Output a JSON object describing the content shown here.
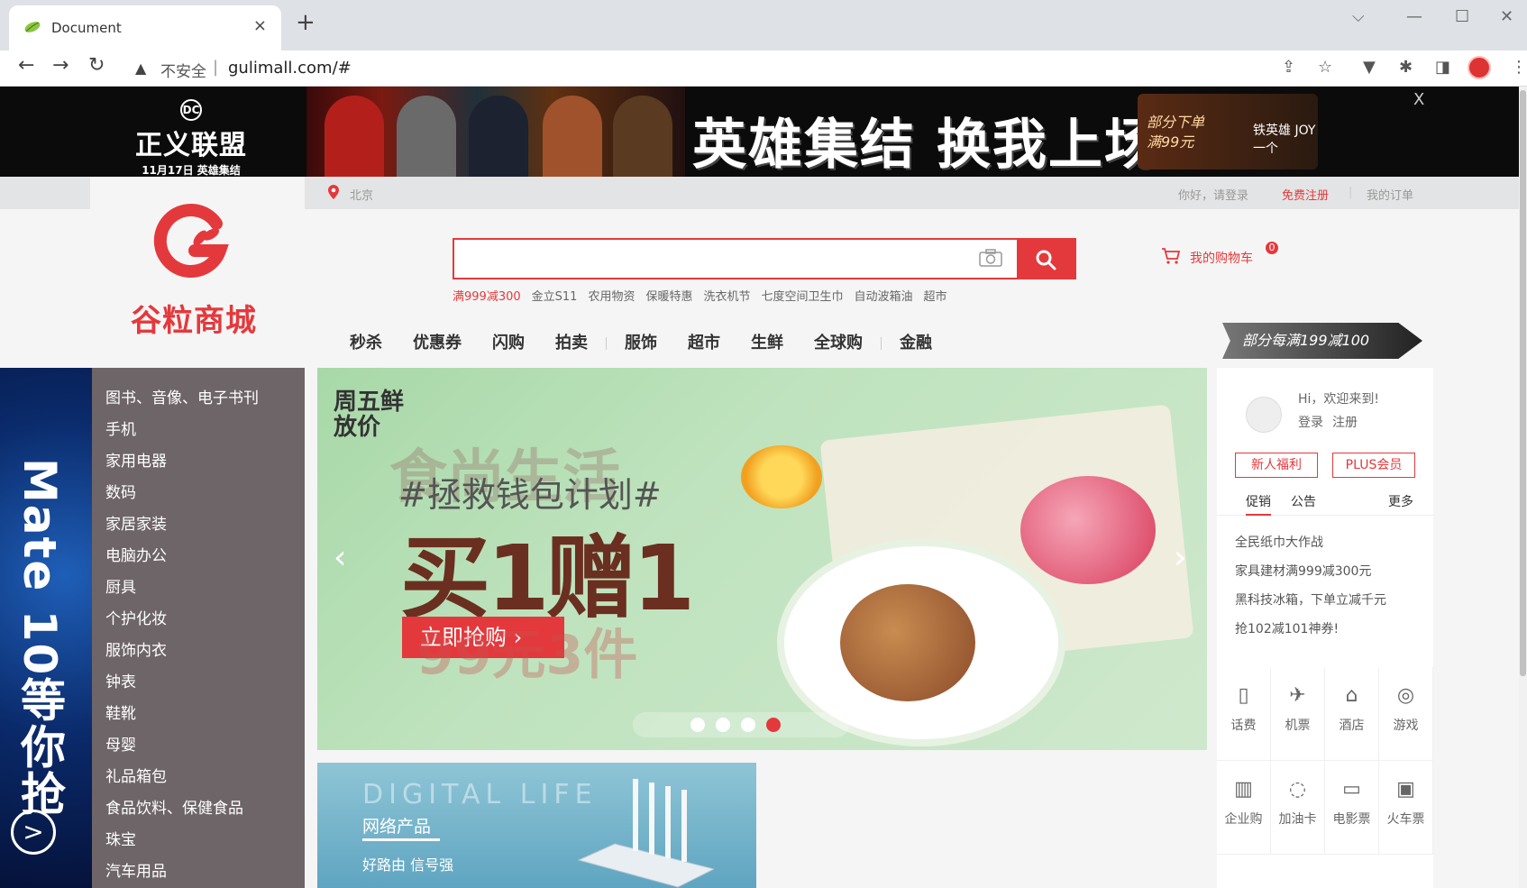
{
  "browser": {
    "tab_title": "Document",
    "tab_close": "×",
    "new_tab": "+",
    "insecure_label": "不安全",
    "address_sep": "|",
    "url": "gulimall.com/#"
  },
  "banner": {
    "brand": "正义联盟",
    "dc": "DC",
    "date": "11月17日 英雄集结",
    "slogan": "英雄集结 换我上场",
    "promo_line1": "部分下单",
    "promo_line2": "满99元",
    "promo_line3": "铁英雄 JOY一个",
    "close": "X"
  },
  "topbar": {
    "location": "北京",
    "login": "你好，请登录",
    "register": "免费注册",
    "sep": "|",
    "orders": "我的订单"
  },
  "header": {
    "logo_text": "谷粒商城",
    "search_placeholder": "",
    "hot_words": [
      "满999减300",
      "金立S11",
      "农用物资",
      "保暖特惠",
      "洗衣机节",
      "七度空间卫生巾",
      "自动波箱油",
      "超市"
    ],
    "cart_label": "我的购物车",
    "cart_count": "0"
  },
  "nav": [
    "秒杀",
    "优惠券",
    "闪购",
    "拍卖",
    "服饰",
    "超市",
    "生鲜",
    "全球购",
    "金融"
  ],
  "promo_badge": "部分每满199减100",
  "left_ad": {
    "text": "Mate 10等你抢",
    "arrow": ">"
  },
  "categories": [
    "图书、音像、电子书刊",
    "手机",
    "家用电器",
    "数码",
    "家居家装",
    "电脑办公",
    "厨具",
    "个护化妆",
    "服饰内衣",
    "钟表",
    "鞋靴",
    "母婴",
    "礼品箱包",
    "食品饮料、保健食品",
    "珠宝",
    "汽车用品"
  ],
  "carousel": {
    "tag": "周五鲜放价",
    "ghost": "食尚生活",
    "plan": "#拯救钱包计划#",
    "headline": "买1赠1",
    "cta": "立即抢购 ›",
    "ghost2": "99元3件",
    "prev": "‹",
    "next": "›",
    "active_dot": 3
  },
  "sub_banner": {
    "en": "DIGITAL LIFE",
    "title": "网络产品",
    "desc": "好路由 信号强"
  },
  "right_panel": {
    "welcome": "Hi，欢迎来到!",
    "login": "登录",
    "register": "注册",
    "new_user": "新人福利",
    "plus": "PLUS会员",
    "tab_promo": "促销",
    "tab_notice": "公告",
    "tab_more": "更多",
    "news": [
      "全民纸巾大作战",
      "家具建材满999减300元",
      "黑科技冰箱，下单立减千元",
      "抢102减101神券!"
    ],
    "services": [
      {
        "label": "话费",
        "icon": "phone-bill-icon",
        "glyph": "▯"
      },
      {
        "label": "机票",
        "icon": "airplane-icon",
        "glyph": "✈"
      },
      {
        "label": "酒店",
        "icon": "hotel-icon",
        "glyph": "⌂"
      },
      {
        "label": "游戏",
        "icon": "gamepad-icon",
        "glyph": "◎"
      },
      {
        "label": "企业购",
        "icon": "building-icon",
        "glyph": "▥"
      },
      {
        "label": "加油卡",
        "icon": "fuel-drop-icon",
        "glyph": "◌"
      },
      {
        "label": "电影票",
        "icon": "movie-camera-icon",
        "glyph": "▭"
      },
      {
        "label": "火车票",
        "icon": "train-icon",
        "glyph": "▣"
      }
    ]
  }
}
